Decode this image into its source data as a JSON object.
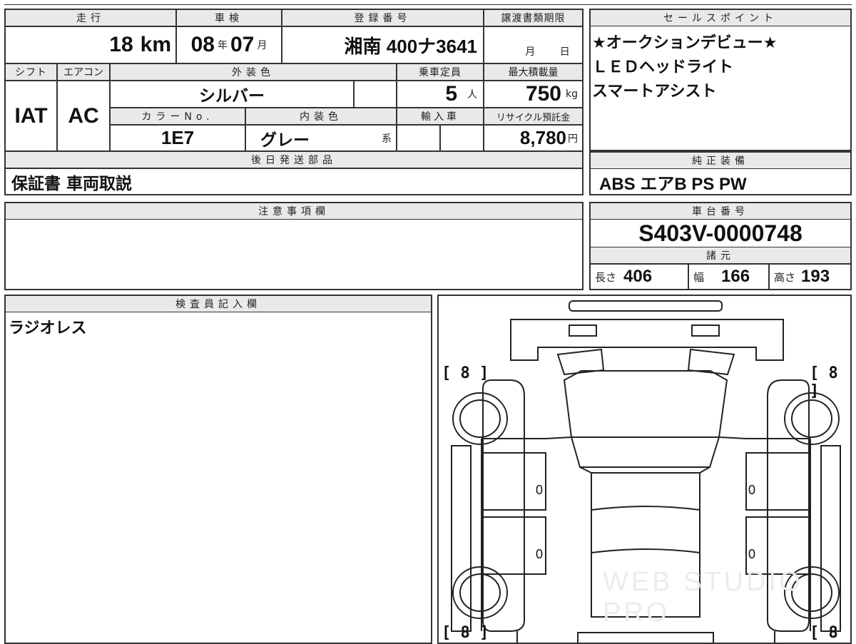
{
  "mileage": {
    "label": "走行",
    "value": "18",
    "unit": "km"
  },
  "inspection": {
    "label": "車検",
    "year": "08",
    "year_unit": "年",
    "month": "07",
    "month_unit": "月"
  },
  "registration": {
    "label": "登録番号",
    "value": "湘南 400ナ3641"
  },
  "transfer_deadline": {
    "label": "譲渡書類期限",
    "month_unit": "月",
    "day_unit": "日"
  },
  "shift": {
    "label": "シフト",
    "value": "IAT"
  },
  "aircon": {
    "label": "エアコン",
    "value": "AC"
  },
  "exterior_color": {
    "label": "外装色",
    "value": "シルバー"
  },
  "capacity": {
    "label": "乗車定員",
    "value": "5",
    "unit": "人"
  },
  "max_load": {
    "label": "最大積載量",
    "value": "750",
    "unit": "kg"
  },
  "color_no": {
    "label": "カラーNo.",
    "value": "1E7"
  },
  "interior_color": {
    "label": "内装色",
    "value": "グレー",
    "suffix": "系"
  },
  "import": {
    "label": "輸入車"
  },
  "recycle": {
    "label": "リサイクル預託金",
    "value": "8,780",
    "unit": "円"
  },
  "later_parts": {
    "label": "後日発送部品",
    "value": "保証書 車両取説"
  },
  "sales_points": {
    "label": "セールスポイント",
    "lines": [
      "★オークションデビュー★",
      "ＬＥＤヘッドライト",
      "スマートアシスト"
    ]
  },
  "equipment": {
    "label": "純正装備",
    "value": "ABS エアB PS PW"
  },
  "notes": {
    "label": "注意事項欄",
    "value": ""
  },
  "chassis": {
    "label": "車台番号",
    "value": "S403V-0000748"
  },
  "specs": {
    "label": "諸元",
    "length": {
      "label": "長さ",
      "value": "406"
    },
    "width": {
      "label": "幅",
      "value": "166"
    },
    "height": {
      "label": "高さ",
      "value": "193"
    }
  },
  "inspector": {
    "label": "検査員記入欄",
    "value": "ラジオレス"
  },
  "diagram": {
    "tire_front_left": "[ 8 ]",
    "tire_front_right": "[ 8 ]",
    "tire_rear_left": "[ 8 ]",
    "tire_rear_right": "[ 8 ]",
    "door_front_left": "0",
    "door_front_right": "0",
    "door_rear_left": "0",
    "door_rear_right": "0",
    "watermark": "WEB STUDIO PRO"
  }
}
